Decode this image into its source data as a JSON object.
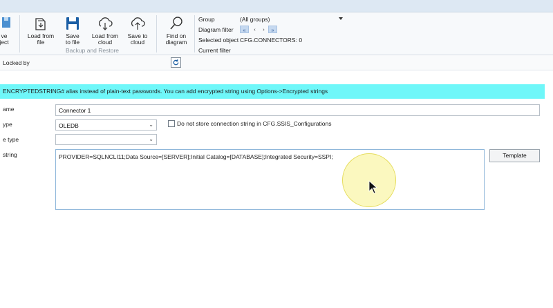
{
  "ribbon": {
    "buttons": [
      {
        "label": "ve\nject",
        "icon": "save-object-icon"
      },
      {
        "label": "Load from\nfile",
        "icon": "folder-open-icon"
      },
      {
        "label": "Save\nto file",
        "icon": "floppy-disk-icon"
      },
      {
        "label": "Load from\ncloud",
        "icon": "cloud-download-icon"
      },
      {
        "label": "Save to\ncloud",
        "icon": "cloud-upload-icon"
      },
      {
        "label": "Find on\ndiagram",
        "icon": "magnifier-icon"
      }
    ],
    "group_label": "Backup and Restore",
    "filter": {
      "group_label": "Group",
      "group_value": "(All groups)",
      "diagram_filter_label": "Diagram filter",
      "nav_first": "«",
      "nav_prev": "‹",
      "nav_next": "›",
      "nav_last": "»",
      "selected_object_label": "Selected object",
      "selected_object_value": "CFG.CONNECTORS: 0",
      "current_filter_label": "Current filter"
    }
  },
  "lockbar": {
    "label": "Locked by",
    "refresh_icon": "refresh-icon"
  },
  "banner": {
    "text": "ENCRYPTEDSTRING# alias instead of plain-text passwords. You can add encrypted string using Options->Encrypted strings"
  },
  "form": {
    "name_label": "ame",
    "name_value": "Connector 1",
    "type_label": "ype",
    "type_value": "OLEDB",
    "no_store_label": "Do not store connection string in CFG.SSIS_Configurations",
    "no_store_checked": false,
    "subtype_label": "e type",
    "subtype_value": "",
    "conn_string_label": "string",
    "conn_string_value": "PROVIDER=SQLNCLI11;Data Source=[SERVER];Initial Catalog=[DATABASE];Integrated Security=SSPI;",
    "template_button": "Template"
  },
  "colors": {
    "banner_bg": "#6ff7f9",
    "ribbon_bg": "#f7f9fb",
    "icon_blue": "#1d5fa3",
    "cursor_halo": "#faf6aa"
  }
}
